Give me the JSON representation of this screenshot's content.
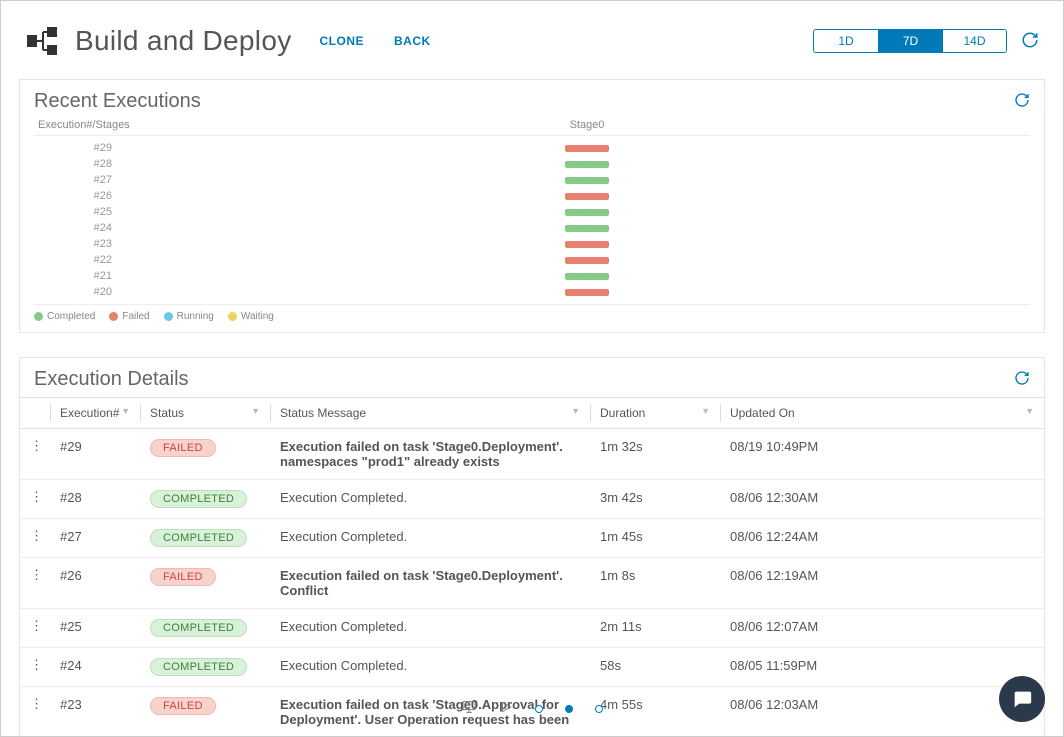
{
  "header": {
    "title": "Build and Deploy",
    "clone": "CLONE",
    "back": "BACK",
    "time_ranges": [
      "1D",
      "7D",
      "14D"
    ],
    "active_range": "7D"
  },
  "recent": {
    "title": "Recent Executions",
    "col_label": "Execution#/Stages",
    "stage_label": "Stage0",
    "legend": {
      "completed": "Completed",
      "failed": "Failed",
      "running": "Running",
      "waiting": "Waiting"
    }
  },
  "chart_data": {
    "type": "table",
    "title": "Recent Executions",
    "columns": [
      "Execution#",
      "Stage0"
    ],
    "rows": [
      {
        "label": "#29",
        "status": "failed"
      },
      {
        "label": "#28",
        "status": "completed"
      },
      {
        "label": "#27",
        "status": "completed"
      },
      {
        "label": "#26",
        "status": "failed"
      },
      {
        "label": "#25",
        "status": "completed"
      },
      {
        "label": "#24",
        "status": "completed"
      },
      {
        "label": "#23",
        "status": "failed"
      },
      {
        "label": "#22",
        "status": "failed"
      },
      {
        "label": "#21",
        "status": "completed"
      },
      {
        "label": "#20",
        "status": "failed"
      }
    ],
    "legend": [
      "Completed",
      "Failed",
      "Running",
      "Waiting"
    ]
  },
  "details": {
    "title": "Execution Details",
    "columns": {
      "exec": "Execution#",
      "status": "Status",
      "msg": "Status Message",
      "dur": "Duration",
      "upd": "Updated On"
    },
    "status_labels": {
      "failed": "FAILED",
      "completed": "COMPLETED"
    },
    "rows": [
      {
        "exec": "#29",
        "status": "failed",
        "msg": "Execution failed on task 'Stage0.Deployment'. namespaces \"prod1\" already exists",
        "bold": true,
        "dur": "1m 32s",
        "upd": "08/19 10:49PM"
      },
      {
        "exec": "#28",
        "status": "completed",
        "msg": "Execution Completed.",
        "bold": false,
        "dur": "3m 42s",
        "upd": "08/06 12:30AM"
      },
      {
        "exec": "#27",
        "status": "completed",
        "msg": "Execution Completed.",
        "bold": false,
        "dur": "1m 45s",
        "upd": "08/06 12:24AM"
      },
      {
        "exec": "#26",
        "status": "failed",
        "msg": "Execution failed on task 'Stage0.Deployment'. Conflict",
        "bold": true,
        "dur": "1m 8s",
        "upd": "08/06 12:19AM"
      },
      {
        "exec": "#25",
        "status": "completed",
        "msg": "Execution Completed.",
        "bold": false,
        "dur": "2m 11s",
        "upd": "08/06 12:07AM"
      },
      {
        "exec": "#24",
        "status": "completed",
        "msg": "Execution Completed.",
        "bold": false,
        "dur": "58s",
        "upd": "08/05 11:59PM"
      },
      {
        "exec": "#23",
        "status": "failed",
        "msg": "Execution failed on task 'Stage0.Approval for Deployment'. User Operation request has been",
        "bold": true,
        "dur": "4m 55s",
        "upd": "08/06 12:03AM"
      }
    ]
  },
  "colors": {
    "accent": "#0079b8",
    "completed": "#87c987",
    "failed": "#e88070"
  }
}
